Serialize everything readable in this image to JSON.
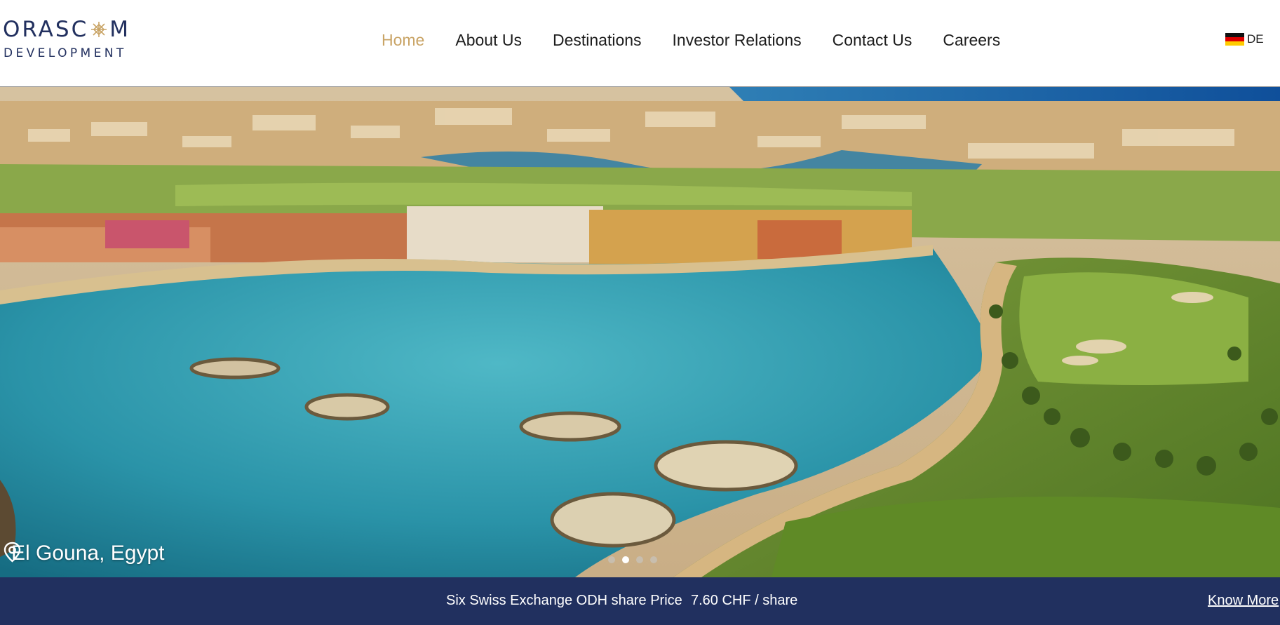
{
  "brand": {
    "name_top_left": "ORASC",
    "name_top_right": "M",
    "name_bottom": "DEVELOPMENT",
    "color_primary": "#22305f",
    "color_accent": "#c9a466"
  },
  "nav": {
    "items": [
      {
        "label": "Home",
        "active": true
      },
      {
        "label": "About Us",
        "active": false
      },
      {
        "label": "Destinations",
        "active": false
      },
      {
        "label": "Investor Relations",
        "active": false
      },
      {
        "label": "Contact Us",
        "active": false
      },
      {
        "label": "Careers",
        "active": false
      }
    ]
  },
  "language": {
    "label": "DE",
    "icon": "germany-flag-icon"
  },
  "hero": {
    "image": "aerial-lagoon-resort-photo",
    "location_icon": "map-pin-icon",
    "location_label": "El Gouna, Egypt",
    "slides": {
      "count": 4,
      "active_index": 1
    }
  },
  "ticker": {
    "label": "Six Swiss Exchange ODH share Price",
    "price": "7.60 CHF / share",
    "link": "Know More",
    "background": "#21305f"
  }
}
